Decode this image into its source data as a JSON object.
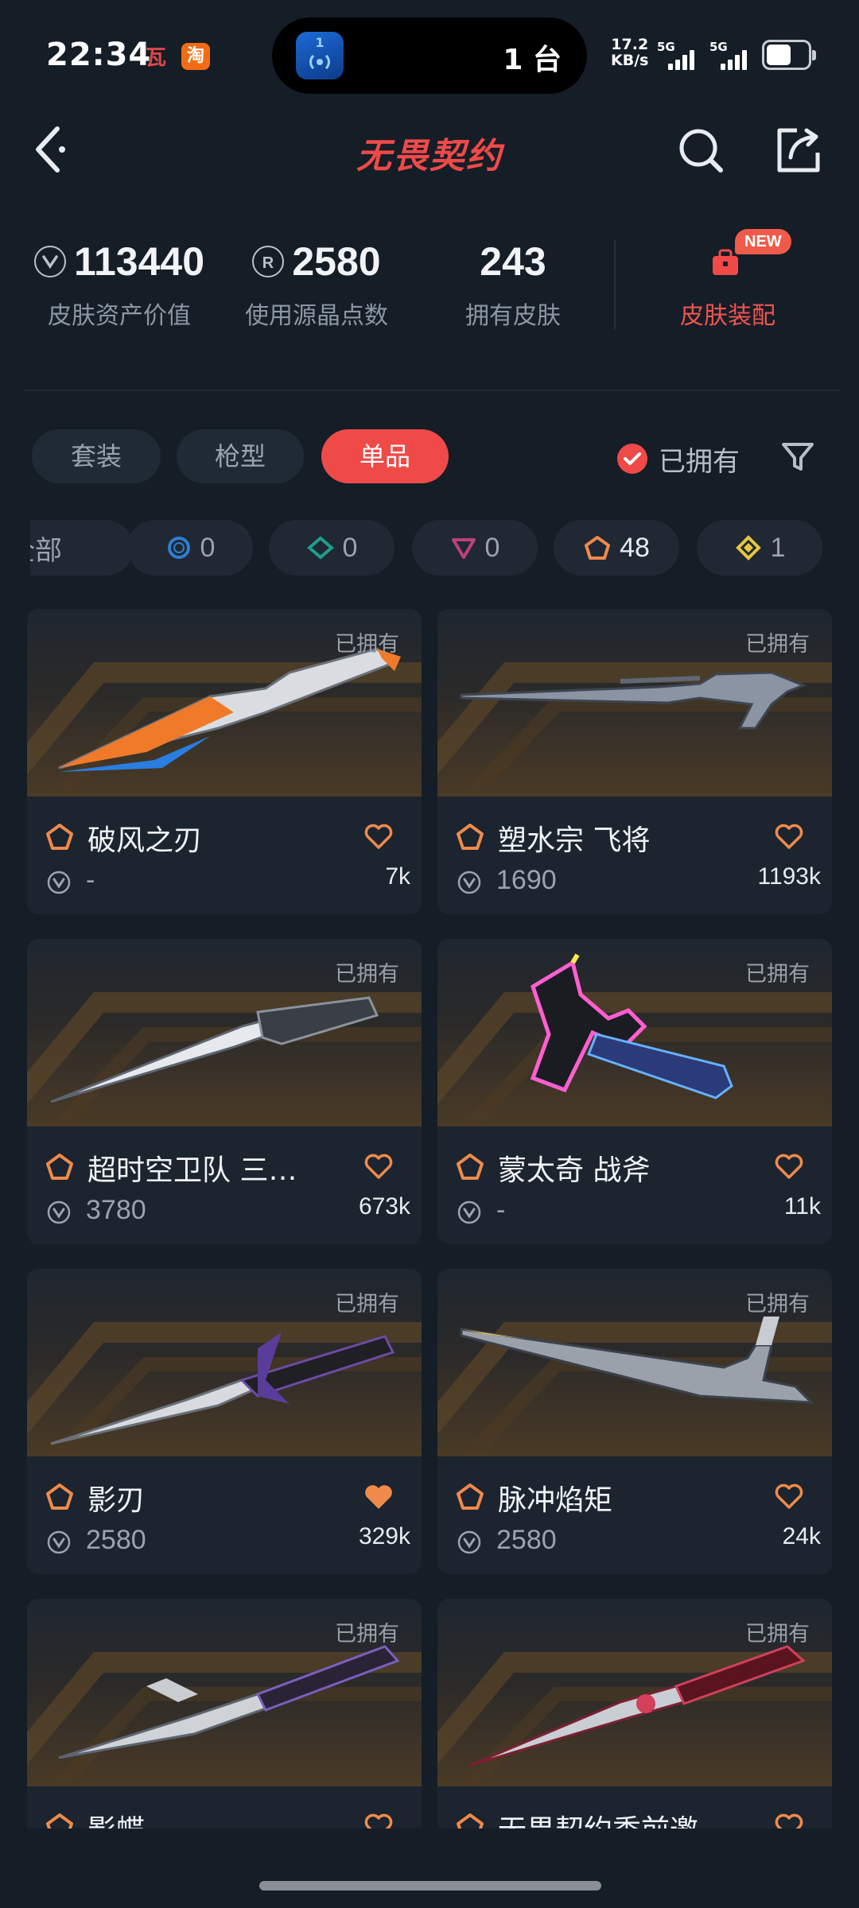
{
  "status_bar": {
    "time": "22:34",
    "app_icon_1": "瓦",
    "app_icon_2": "淘",
    "island_badge": "1",
    "island_text": "1 台",
    "net_speed": "17.2",
    "net_unit": "KB/s",
    "sim1": "5G",
    "sim2": "5G"
  },
  "header": {
    "title": "无畏契约"
  },
  "stats": [
    {
      "value": "113440",
      "label": "皮肤资产价值",
      "icon": "vp-coin-icon"
    },
    {
      "value": "2580",
      "label": "使用源晶点数",
      "icon": "radianite-icon"
    },
    {
      "value": "243",
      "label": "拥有皮肤"
    }
  ],
  "loadout": {
    "label": "皮肤装配",
    "badge": "NEW"
  },
  "tabs": [
    {
      "label": "套装",
      "active": false
    },
    {
      "label": "枪型",
      "active": false
    },
    {
      "label": "单品",
      "active": true
    }
  ],
  "owned_filter": {
    "label": "已拥有",
    "checked": true
  },
  "tiers": [
    {
      "label": "全部"
    },
    {
      "count": "0",
      "tier": "select",
      "color": "#2f7fd0"
    },
    {
      "count": "0",
      "tier": "deluxe",
      "color": "#1f9e8a"
    },
    {
      "count": "0",
      "tier": "premium",
      "color": "#c0407a"
    },
    {
      "count": "48",
      "tier": "exclusive",
      "color": "#f08a4b"
    },
    {
      "count": "1",
      "tier": "ultra",
      "color": "#e8c640"
    }
  ],
  "cards": [
    {
      "name": "破风之刃",
      "price": "-",
      "likes": "7k",
      "owned": "已拥有",
      "liked": false
    },
    {
      "name": "塑水宗 飞将",
      "price": "1690",
      "likes": "1193k",
      "owned": "已拥有",
      "liked": false
    },
    {
      "name": "超时空卫队 三…",
      "price": "3780",
      "likes": "673k",
      "owned": "已拥有",
      "liked": false
    },
    {
      "name": "蒙太奇 战斧",
      "price": "-",
      "likes": "11k",
      "owned": "已拥有",
      "liked": false
    },
    {
      "name": "影刃",
      "price": "2580",
      "likes": "329k",
      "owned": "已拥有",
      "liked": true
    },
    {
      "name": "脉冲焰矩",
      "price": "2580",
      "likes": "24k",
      "owned": "已拥有",
      "liked": false
    },
    {
      "name": "影蝶",
      "price": "",
      "likes": "",
      "owned": "已拥有",
      "liked": false
    },
    {
      "name": "无畏契约季前邀…",
      "price": "",
      "likes": "",
      "owned": "已拥有",
      "liked": false
    }
  ],
  "colors": {
    "accent": "#ef4a48",
    "tier_exclusive": "#f08a4b",
    "background": "#151d27"
  }
}
